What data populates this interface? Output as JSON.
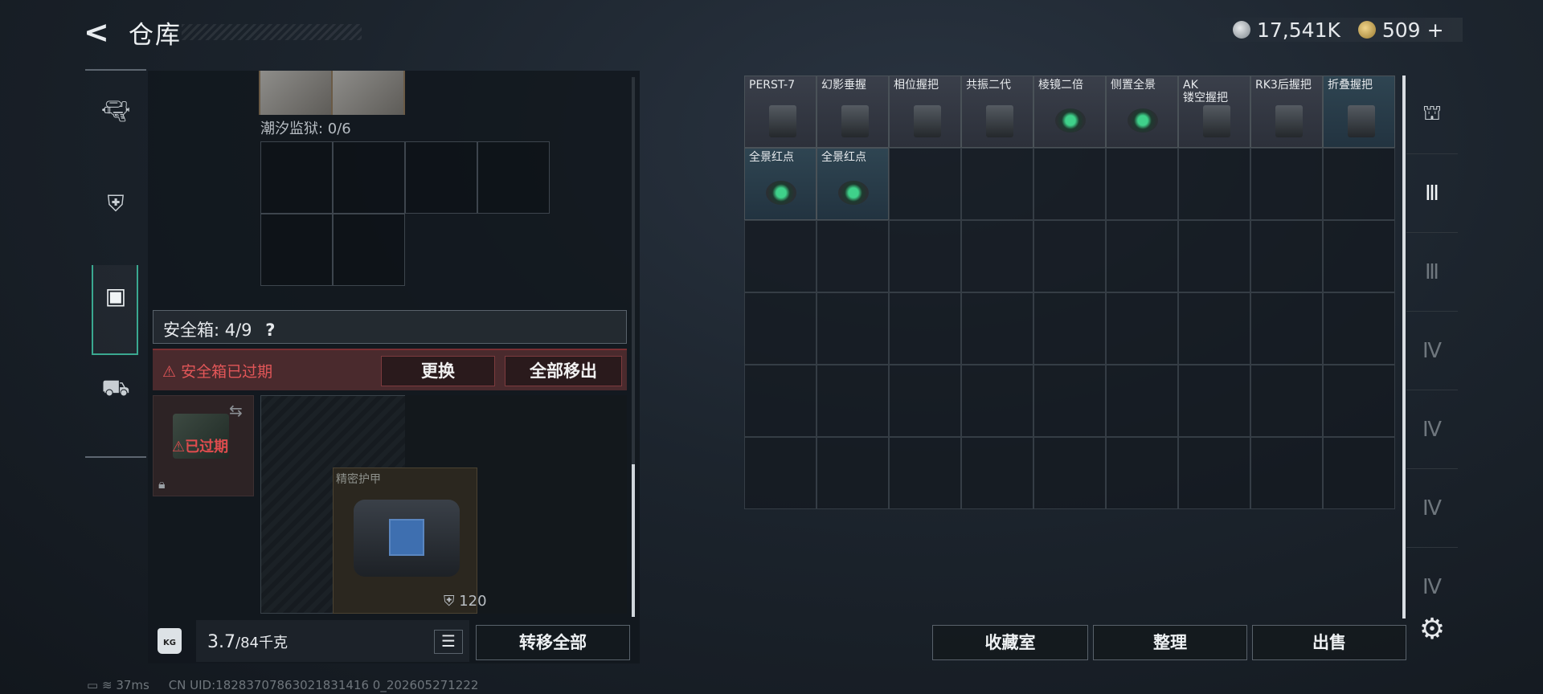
{
  "header": {
    "back": "<",
    "title": "仓库"
  },
  "currency": {
    "silver": "17,541K",
    "gold": "509",
    "gold_plus": "+"
  },
  "left_rail": {
    "items": [
      "pistol-icon",
      "armor-plate-icon",
      "backpack-icon",
      "toolbox-icon"
    ]
  },
  "storage": {
    "prison_label": "潮汐监狱: 0/6"
  },
  "safe_box": {
    "label": "安全箱: 4/9",
    "help": "?",
    "expired_warning": "安全箱已过期",
    "replace_button": "更换",
    "remove_all_button": "全部移出",
    "expired_badge": "已过期",
    "item_name": "精密护甲",
    "item_value": "120"
  },
  "weight": {
    "current": "3.7",
    "max": "/84千克",
    "unit_icon": "KG"
  },
  "transfer_all": "转移全部",
  "grid_items": [
    {
      "label": "PERST-7",
      "kind": "laser"
    },
    {
      "label": "幻影垂握",
      "kind": "grip"
    },
    {
      "label": "相位握把",
      "kind": "grip"
    },
    {
      "label": "共振二代",
      "kind": "grip"
    },
    {
      "label": "棱镜二倍",
      "kind": "scope"
    },
    {
      "label": "侧置全景",
      "kind": "scope"
    },
    {
      "label": "AK\n镂空握把",
      "kind": "grip"
    },
    {
      "label": "RK3后握把",
      "kind": "grip"
    },
    {
      "label": "折叠握把",
      "kind": "grip"
    },
    {
      "label": "全景红点",
      "kind": "reddot"
    },
    {
      "label": "全景红点",
      "kind": "reddot"
    }
  ],
  "bottom_buttons": {
    "collection": "收藏室",
    "sort": "整理",
    "sell": "出售"
  },
  "status_bar": {
    "ping": "37ms",
    "uid": "CN UID:18283707863021831416 0_202605271222"
  },
  "colors": {
    "accent": "#3aa890",
    "warning": "#e25658"
  }
}
